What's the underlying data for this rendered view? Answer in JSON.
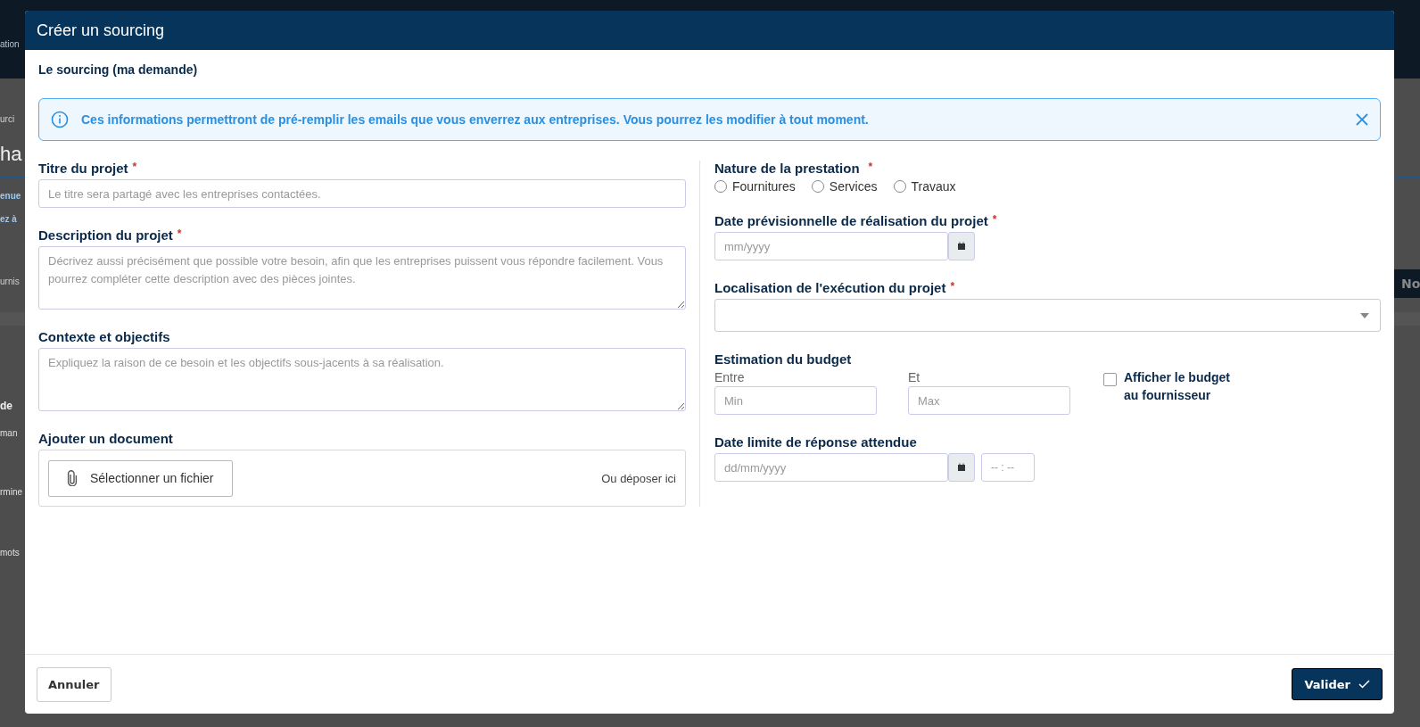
{
  "background": {
    "top_bar_text": "ation",
    "right_header": "No",
    "fragments": [
      {
        "kind": "crumb",
        "text": "urci"
      },
      {
        "kind": "heading",
        "text": "ha"
      },
      {
        "kind": "link",
        "text": "enue"
      },
      {
        "kind": "link",
        "text": "ez à"
      },
      {
        "kind": "faint",
        "text": "urnis"
      },
      {
        "kind": "bold",
        "text": "de"
      },
      {
        "kind": "text",
        "text": "man"
      },
      {
        "kind": "text",
        "text": "rmine"
      },
      {
        "kind": "text",
        "text": "mots"
      }
    ]
  },
  "modal": {
    "title": "Créer un sourcing",
    "section_title": "Le sourcing (ma demande)",
    "info": {
      "text": "Ces informations permettront de pré-remplir les emails que vous enverrez aux entreprises. Vous pourrez les modifier à tout moment."
    }
  },
  "left_fields": [
    {
      "kind": "input",
      "label": "Titre du projet",
      "required_mark": "*",
      "placeholder": "Le titre sera partagé avec les entreprises contactées."
    },
    {
      "kind": "textarea",
      "label": "Description du projet",
      "required_mark": "*",
      "placeholder": "Décrivez aussi précisément que possible votre besoin, afin que les entreprises puissent vous répondre facilement. Vous pourrez compléter cette description avec des pièces jointes."
    },
    {
      "kind": "textarea",
      "label": "Contexte et objectifs",
      "placeholder": "Expliquez la raison de ce besoin et les objectifs sous-jacents à sa réalisation."
    },
    {
      "kind": "file",
      "label": "Ajouter un document",
      "button": "Sélectionner un fichier",
      "drop_hint": "Ou déposer ici"
    }
  ],
  "nature": {
    "label": "Nature de la prestation",
    "required_mark": "*",
    "options": [
      {
        "label": "Fournitures",
        "selected": false
      },
      {
        "label": "Services",
        "selected": false
      },
      {
        "label": "Travaux",
        "selected": false
      }
    ]
  },
  "planned_date": {
    "label": "Date prévisionnelle de réalisation du projet",
    "required_mark": "*",
    "placeholder": "mm/yyyy"
  },
  "location": {
    "label": "Localisation de l'exécution du projet",
    "required_mark": "*"
  },
  "budget": {
    "label": "Estimation du budget",
    "min_label": "Entre",
    "min_placeholder": "Min",
    "max_label": "Et",
    "max_placeholder": "Max",
    "show_label": "Afficher le budget",
    "show_label_2": "au fournisseur",
    "checked": false
  },
  "deadline": {
    "label": "Date limite de réponse attendue",
    "date_placeholder": "dd/mm/yyyy",
    "time_placeholder": "-- : --"
  },
  "footer": {
    "cancel": "Annuler",
    "submit": "Valider"
  }
}
